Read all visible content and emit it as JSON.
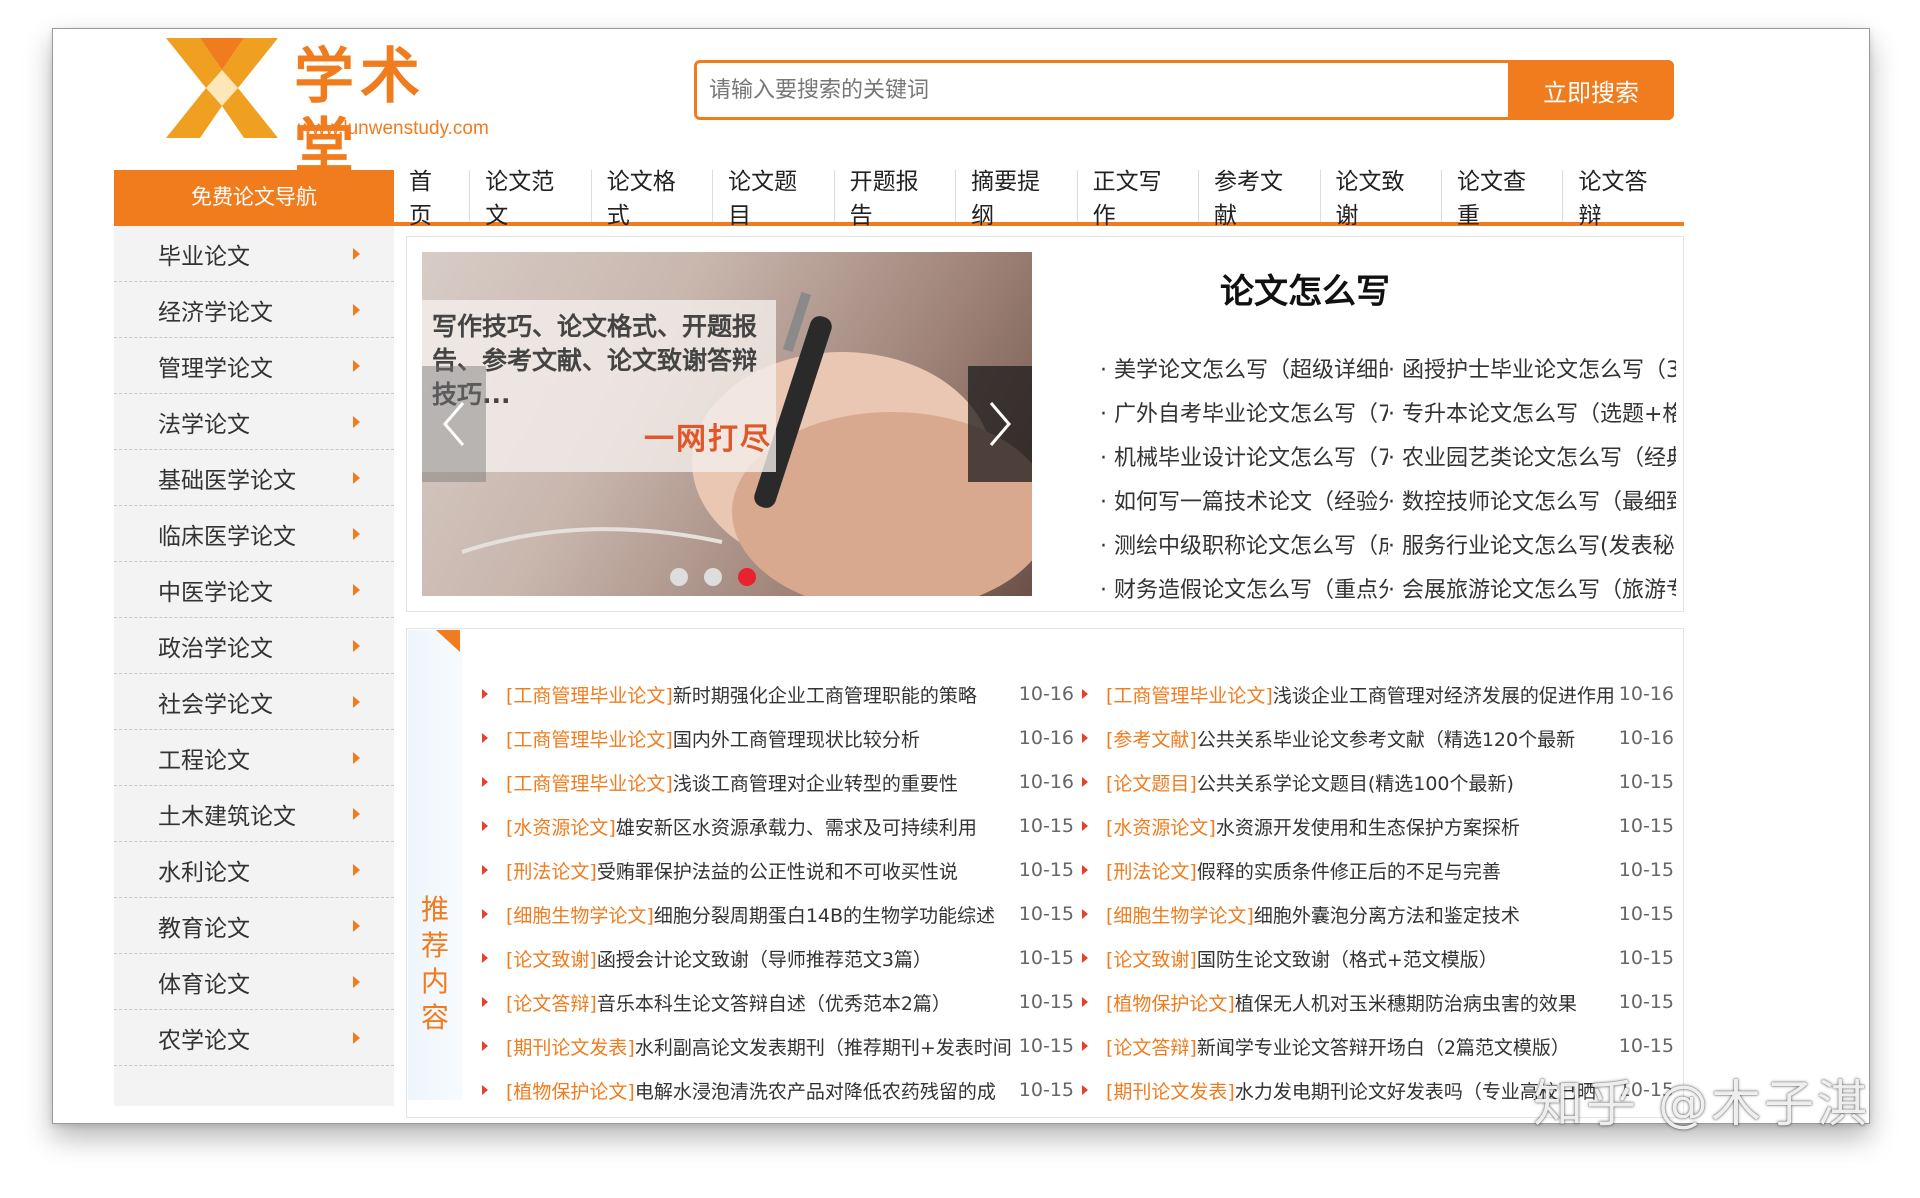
{
  "header": {
    "site_name": "学术堂",
    "site_url": "www.lunwenstudy.com",
    "search_placeholder": "请输入要搜索的关键词",
    "search_button": "立即搜索"
  },
  "nav": {
    "category_label": "免费论文导航",
    "links": [
      "首页",
      "论文范文",
      "论文格式",
      "论文题目",
      "开题报告",
      "摘要提纲",
      "正文写作",
      "参考文献",
      "论文致谢",
      "论文查重",
      "论文答辩"
    ]
  },
  "sidebar": {
    "items": [
      "毕业论文",
      "经济学论文",
      "管理学论文",
      "法学论文",
      "基础医学论文",
      "临床医学论文",
      "中医学论文",
      "政治学论文",
      "社会学论文",
      "工程论文",
      "土木建筑论文",
      "水利论文",
      "教育论文",
      "体育论文",
      "农学论文"
    ]
  },
  "slider": {
    "caption": "写作技巧、论文格式、开题报告、参考文献、论文致谢答辩技巧...",
    "slogan": "一网打尽",
    "active_dot": 2
  },
  "howto": {
    "title": "论文怎么写",
    "rows": [
      [
        "· 美学论文怎么写（超级详细的",
        "· 函授护士毕业论文怎么写（3"
      ],
      [
        "· 广外自考毕业论文怎么写（7",
        "· 专升本论文怎么写（选题+格"
      ],
      [
        "· 机械毕业设计论文怎么写（7",
        "· 农业园艺类论文怎么写（经典"
      ],
      [
        "· 如何写一篇技术论文（经验分",
        "· 数控技师论文怎么写（最细致"
      ],
      [
        "· 测绘中级职称论文怎么写（成",
        "· 服务行业论文怎么写(发表秘"
      ],
      [
        "· 财务造假论文怎么写（重点分",
        "· 会展旅游论文怎么写（旅游专"
      ]
    ]
  },
  "recommended": {
    "label": "推荐内容",
    "rows": [
      [
        {
          "cat": "[工商管理毕业论文]",
          "title": "新时期强化企业工商管理职能的策略",
          "date": "10-16"
        },
        {
          "cat": "[工商管理毕业论文]",
          "title": "浅谈企业工商管理对经济发展的促进作用",
          "date": "10-16"
        }
      ],
      [
        {
          "cat": "[工商管理毕业论文]",
          "title": "国内外工商管理现状比较分析",
          "date": "10-16"
        },
        {
          "cat": "[参考文献]",
          "title": "公共关系毕业论文参考文献（精选120个最新",
          "date": "10-16"
        }
      ],
      [
        {
          "cat": "[工商管理毕业论文]",
          "title": "浅谈工商管理对企业转型的重要性",
          "date": "10-16"
        },
        {
          "cat": "[论文题目]",
          "title": "公共关系学论文题目(精选100个最新)",
          "date": "10-15"
        }
      ],
      [
        {
          "cat": "[水资源论文]",
          "title": "雄安新区水资源承载力、需求及可持续利用",
          "date": "10-15"
        },
        {
          "cat": "[水资源论文]",
          "title": "水资源开发使用和生态保护方案探析",
          "date": "10-15"
        }
      ],
      [
        {
          "cat": "[刑法论文]",
          "title": "受贿罪保护法益的公正性说和不可收买性说",
          "date": "10-15"
        },
        {
          "cat": "[刑法论文]",
          "title": "假释的实质条件修正后的不足与完善",
          "date": "10-15"
        }
      ],
      [
        {
          "cat": "[细胞生物学论文]",
          "title": "细胞分裂周期蛋白14B的生物学功能综述",
          "date": "10-15"
        },
        {
          "cat": "[细胞生物学论文]",
          "title": "细胞外囊泡分离方法和鉴定技术",
          "date": "10-15"
        }
      ],
      [
        {
          "cat": "[论文致谢]",
          "title": "函授会计论文致谢（导师推荐范文3篇）",
          "date": "10-15"
        },
        {
          "cat": "[论文致谢]",
          "title": "国防生论文致谢（格式+范文模版）",
          "date": "10-15"
        }
      ],
      [
        {
          "cat": "[论文答辩]",
          "title": "音乐本科生论文答辩自述（优秀范本2篇）",
          "date": "10-15"
        },
        {
          "cat": "[植物保护论文]",
          "title": "植保无人机对玉米穗期防治病虫害的效果",
          "date": "10-15"
        }
      ],
      [
        {
          "cat": "[期刊论文发表]",
          "title": "水利副高论文发表期刊（推荐期刊+发表时间",
          "date": "10-15"
        },
        {
          "cat": "[论文答辩]",
          "title": "新闻学专业论文答辩开场白（2篇范文模版）",
          "date": "10-15"
        }
      ],
      [
        {
          "cat": "[植物保护论文]",
          "title": "电解水浸泡清洗农产品对降低农药残留的成",
          "date": "10-15"
        },
        {
          "cat": "[期刊论文发表]",
          "title": "水力发电期刊论文好发表吗（专业高校已晒",
          "date": "10-15"
        }
      ]
    ]
  },
  "watermark": "知乎 @木子淇",
  "colors": {
    "accent": "#f07c1e",
    "active_dot": "#e8222f",
    "bullet": "#e3422a"
  }
}
